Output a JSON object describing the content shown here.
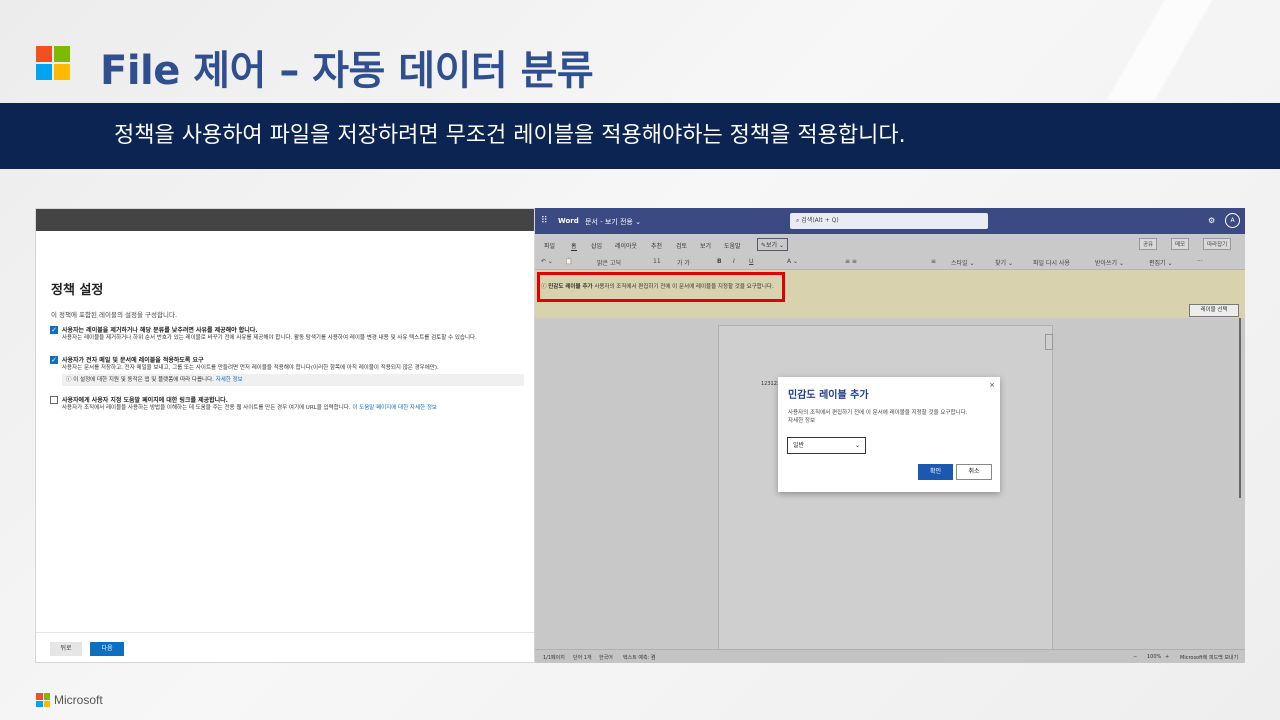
{
  "slide": {
    "title": "File 제어 – 자동 데이터 분류",
    "banner": "정책을 사용하여 파일을 저장하려면 무조건 레이블을 적용해야하는 정책을 적용합니다.",
    "footer_brand": "Microsoft",
    "logo_colors": [
      "#f25022",
      "#7fba00",
      "#00a4ef",
      "#ffb900"
    ]
  },
  "policy_panel": {
    "heading": "정책 설정",
    "subtitle": "이 정책에 포함된 레이블의 설정을 구성합니다.",
    "options": [
      {
        "checked": true,
        "title": "사용자는 레이블을 제거하거나 해당 분류를 낮추려면 사유를 제공해야 합니다.",
        "desc": "사용자는 레이블을 제거하거나 하위 순서 번호가 있는 레이블로 바꾸기 전에 사유를 제공해야 합니다. 활동 탐색기를 사용하여 레이블 변경 내용 및 사유 텍스트를 검토할 수 있습니다."
      },
      {
        "checked": true,
        "title": "사용자가 전자 메일 및 문서에 레이블을 적용하도록 요구",
        "desc": "사용자는 문서를 저장하고, 전자 메일을 보내고, 그룹 또는 사이트를 만들려면 먼저 레이블을 적용해야 합니다(이러한 항목에 아직 레이블이 적용되지 않은 경우에만).",
        "info": "이 설정에 대한 지원 및 동작은 앱 및 플랫폼에 따라 다릅니다.",
        "info_link": "자세한 정보"
      },
      {
        "checked": false,
        "title": "사용자에게 사용자 지정 도움말 페이지에 대한 링크를 제공합니다.",
        "desc": "사용자가 조직에서 레이블을 사용하는 방법을 이해하는 데 도움을 주는 전용 웹 사이트를 만든 경우 여기에 URL을 입력합니다.",
        "link": "이 도움말 페이지에 대한 자세한 정보"
      }
    ],
    "back_label": "뒤로",
    "next_label": "다음"
  },
  "word": {
    "app_name": "Word",
    "doc_title": "문서 - 보기 전용 ⌄",
    "search_placeholder": "검색(Alt + Q)",
    "avatar_initial": "A",
    "menu": [
      "파일",
      "홈",
      "삽입",
      "레이아웃",
      "추천",
      "검토",
      "보기",
      "도움말"
    ],
    "edit_mode": "✎보기 ⌄",
    "share": "공유",
    "comment": "메모",
    "follow": "따라잡기",
    "toolbar": [
      "↶ ⌄",
      "📋",
      "맑은 고딕",
      "11",
      "가 가",
      "B",
      "I",
      "U",
      "A ⌄",
      "≡ ≡",
      "≡",
      "스타일 ⌄",
      "찾기 ⌄",
      "파일 다시 사용",
      "받아쓰기 ⌄",
      "편집기 ⌄",
      "···"
    ],
    "info_bold": "민감도 레이블 추가",
    "info_text": "사용자의 조직에서 편집하기 전에 이 문서에 레이블을 지정할 것을 요구합니다.",
    "label_button": "레이블 선택",
    "doc_text": "123123",
    "status": [
      "1/1페이지",
      "단어 1개",
      "한국어",
      "텍스트 예측: 켬",
      "−",
      "100%",
      "+",
      "Microsoft에 피드백 보내기"
    ]
  },
  "dialog": {
    "title": "민감도 레이블 추가",
    "body": "사용자의 조직에서 편집하기 전에 이 문서에 레이블을 지정할 것을 요구합니다.",
    "more": "자세한 정보",
    "select_value": "일반",
    "ok": "확인",
    "cancel": "취소",
    "close": "×"
  }
}
